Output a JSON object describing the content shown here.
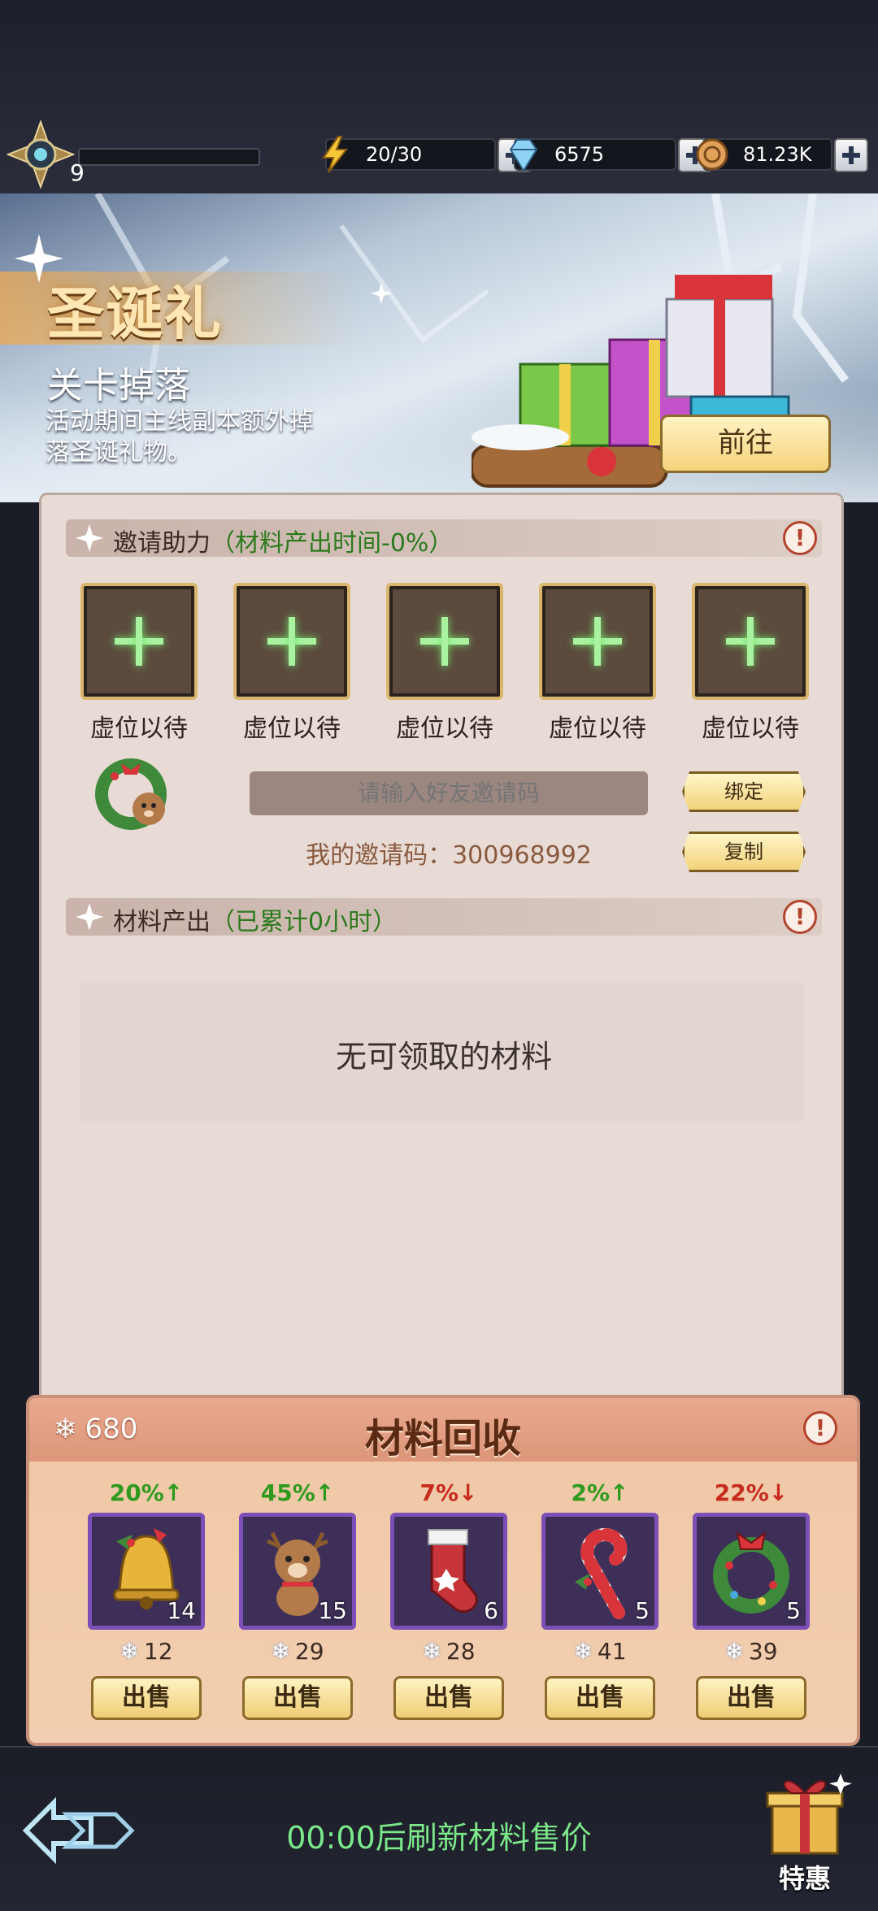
{
  "topbar": {
    "level": "9",
    "energy": "20/30",
    "gems": "6575",
    "coins": "81.23K"
  },
  "banner": {
    "title": "圣诞礼",
    "subtitle": "关卡掉落",
    "description": "活动期间主线副本额外掉落圣诞礼物。",
    "goto_label": "前往"
  },
  "invite": {
    "title": "邀请助力",
    "note": "（材料产出时间-0%）",
    "slots": [
      "虚位以待",
      "虚位以待",
      "虚位以待",
      "虚位以待",
      "虚位以待"
    ],
    "code_placeholder": "请输入好友邀请码",
    "my_code": "我的邀请码：300968992",
    "bind_label": "绑定",
    "copy_label": "复制"
  },
  "materials": {
    "title": "材料产出",
    "note": "（已累计0小时）",
    "empty_text": "无可领取的材料"
  },
  "recycle": {
    "title": "材料回收",
    "snowflake_total": "680",
    "items": [
      {
        "icon": "bell-icon",
        "pct": "20%↑",
        "trend": "up",
        "count": "14",
        "price": "12",
        "sell": "出售"
      },
      {
        "icon": "reindeer-icon",
        "pct": "45%↑",
        "trend": "up",
        "count": "15",
        "price": "29",
        "sell": "出售"
      },
      {
        "icon": "stocking-icon",
        "pct": "7%↓",
        "trend": "down",
        "count": "6",
        "price": "28",
        "sell": "出售"
      },
      {
        "icon": "candy-cane-icon",
        "pct": "2%↑",
        "trend": "up",
        "count": "5",
        "price": "41",
        "sell": "出售"
      },
      {
        "icon": "wreath-icon",
        "pct": "22%↓",
        "trend": "down",
        "count": "5",
        "price": "39",
        "sell": "出售"
      }
    ]
  },
  "bottom": {
    "refresh_text": "00:00后刷新材料售价",
    "deal_label": "特惠"
  },
  "colors": {
    "accent_green": "#7be88a",
    "up": "#2f9a1e",
    "down": "#c72b1d",
    "panel_bg": "#e8dbd5"
  }
}
